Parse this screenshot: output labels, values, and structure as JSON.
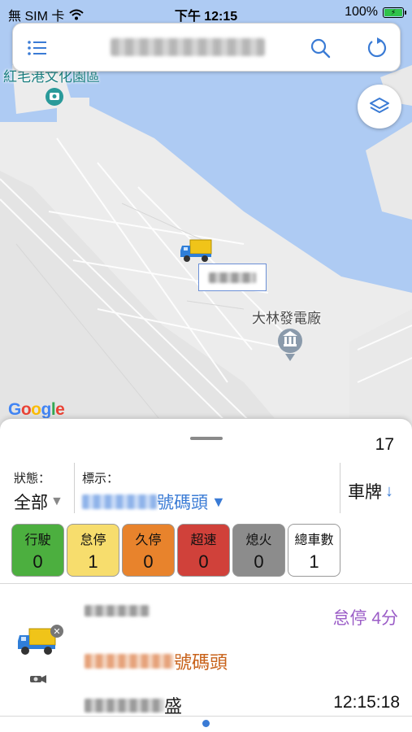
{
  "status_bar": {
    "carrier": "無 SIM 卡",
    "time": "下午 12:15",
    "battery": "100%"
  },
  "topbar": {
    "title": "",
    "menu_icon": "list-icon",
    "search_icon": "search-icon",
    "refresh_icon": "refresh-icon"
  },
  "map": {
    "labels": {
      "park": "紅毛港文化園區",
      "power_plant": "大林發電廠"
    },
    "google_logo": [
      "G",
      "o",
      "o",
      "g",
      "l",
      "e"
    ],
    "layers_icon": "layers-icon",
    "truck_marker_icon": "truck-icon",
    "callout_plate": "■■■-■■"
  },
  "sheet": {
    "count": "17",
    "filters": {
      "status_label": "狀態：",
      "status_value": "全部",
      "mark_label": "標示：",
      "mark_value_suffix": "號碼頭",
      "sort_label": "車牌"
    },
    "status_boxes": [
      {
        "label": "行駛",
        "count": "0",
        "color": "#4caf3f"
      },
      {
        "label": "怠停",
        "count": "1",
        "color": "#f7dd6d"
      },
      {
        "label": "久停",
        "count": "0",
        "color": "#e8832c"
      },
      {
        "label": "超速",
        "count": "0",
        "color": "#d0413a"
      },
      {
        "label": "熄火",
        "count": "0",
        "color": "#8c8c8c"
      },
      {
        "label": "總車數",
        "count": "1",
        "color": "#ffffff"
      }
    ],
    "vehicle": {
      "plate": "■■■-■■",
      "mark_suffix": "號碼頭",
      "driver_suffix": "盛",
      "state": "怠停 4分",
      "time": "12:15:18",
      "icon": "truck-icon",
      "close_icon": "close-icon",
      "camera_icon": "camera-icon"
    }
  },
  "colors": {
    "accent": "#3a7bd5",
    "idle_state_text": "#9b5dc7",
    "mark_text": "#c8621a"
  }
}
